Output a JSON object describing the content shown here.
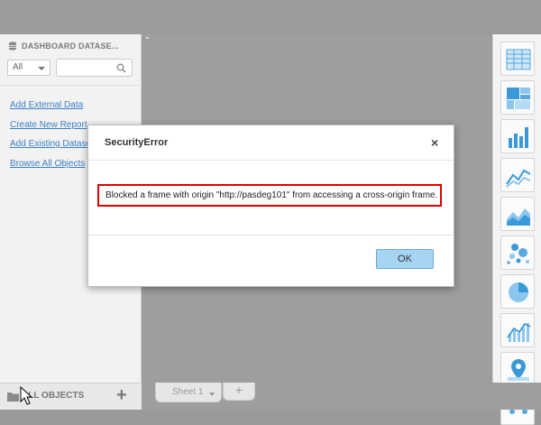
{
  "left_panel": {
    "title": "DASHBOARD DATASE...",
    "filter_value": "All",
    "search_placeholder": "",
    "links": [
      {
        "label": "Add External Data"
      },
      {
        "label": "Create New Report"
      },
      {
        "label": "Add Existing Datase"
      },
      {
        "label": "Browse All Objects"
      }
    ]
  },
  "bottom_bar": {
    "all_objects_label": "ALL OBJECTS",
    "add_label": "+",
    "sheet_tab_label": "Sheet 1",
    "add_sheet_label": "+"
  },
  "dialog": {
    "title": "SecurityError",
    "close_label": "×",
    "message": "Blocked a frame with origin \"http://pasdeg101\" from accessing a cross-origin frame.",
    "ok_label": "OK"
  },
  "right_toolbar": {
    "icons": [
      "grid-table-icon",
      "heatmap-icon",
      "bar-chart-icon",
      "line-chart-icon",
      "area-chart-icon",
      "bubble-chart-icon",
      "pie-chart-icon",
      "combo-chart-icon",
      "map-icon",
      "network-icon"
    ]
  },
  "colors": {
    "accent": "#3b7fc4",
    "highlight": "#e00000",
    "ok_button": "#a8d4f4"
  }
}
